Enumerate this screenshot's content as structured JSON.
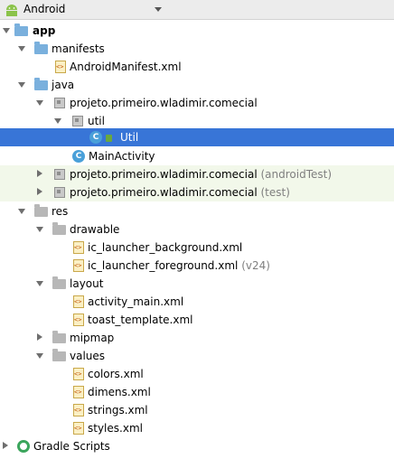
{
  "header": {
    "title": "Android",
    "icon": "android-icon"
  },
  "tree": [
    {
      "label": "app",
      "bold": true
    },
    {
      "label": "manifests"
    },
    {
      "label": "AndroidManifest.xml"
    },
    {
      "label": "java"
    },
    {
      "label": "projeto.primeiro.wladimir.comecial"
    },
    {
      "label": "util"
    },
    {
      "label": "Util"
    },
    {
      "label": "MainActivity"
    },
    {
      "label": "projeto.primeiro.wladimir.comecial",
      "suffix": "(androidTest)"
    },
    {
      "label": "projeto.primeiro.wladimir.comecial",
      "suffix": "(test)"
    },
    {
      "label": "res"
    },
    {
      "label": "drawable"
    },
    {
      "label": "ic_launcher_background.xml"
    },
    {
      "label": "ic_launcher_foreground.xml",
      "suffix": "(v24)"
    },
    {
      "label": "layout"
    },
    {
      "label": "activity_main.xml"
    },
    {
      "label": "toast_template.xml"
    },
    {
      "label": "mipmap"
    },
    {
      "label": "values"
    },
    {
      "label": "colors.xml"
    },
    {
      "label": "dimens.xml"
    },
    {
      "label": "strings.xml"
    },
    {
      "label": "styles.xml"
    },
    {
      "label": "Gradle Scripts"
    }
  ],
  "class_badge": "C",
  "colors": {
    "selection": "#3875d7",
    "test_row": "#f2f8ea",
    "suffix": "#7f7f7f"
  }
}
